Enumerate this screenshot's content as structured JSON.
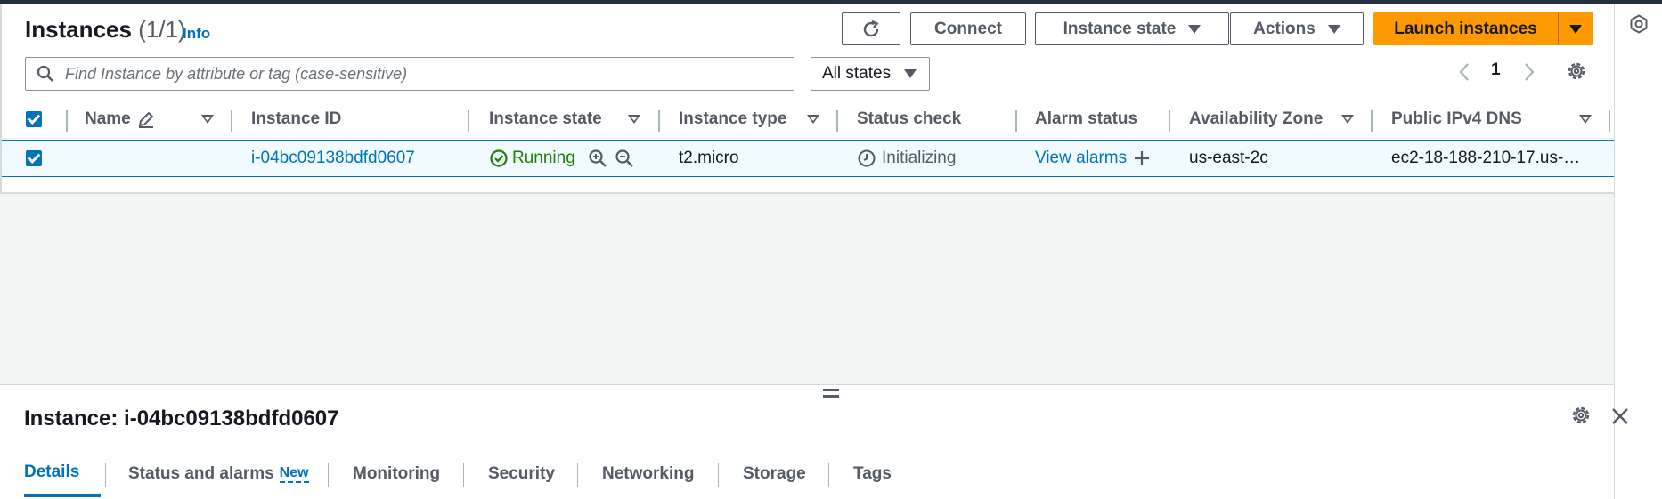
{
  "header": {
    "title": "Instances",
    "count": "(1/1)",
    "info": "Info"
  },
  "toolbar": {
    "connect": "Connect",
    "instance_state": "Instance state",
    "actions": "Actions",
    "launch": "Launch instances"
  },
  "search": {
    "placeholder": "Find Instance by attribute or tag (case-sensitive)"
  },
  "filter": {
    "selected": "All states"
  },
  "pagination": {
    "page": "1"
  },
  "table": {
    "columns": {
      "name": "Name",
      "instance_id": "Instance ID",
      "instance_state": "Instance state",
      "instance_type": "Instance type",
      "status_check": "Status check",
      "alarm_status": "Alarm status",
      "availability_zone": "Availability Zone",
      "public_dns": "Public IPv4 DNS"
    },
    "rows": [
      {
        "instance_id": "i-04bc09138bdfd0607",
        "instance_state": "Running",
        "instance_type": "t2.micro",
        "status_check": "Initializing",
        "alarm_status": "View alarms",
        "availability_zone": "us-east-2c",
        "public_dns": "ec2-18-188-210-17.us-…"
      }
    ]
  },
  "details": {
    "title": "Instance: i-04bc09138bdfd0607",
    "tabs": [
      {
        "label": "Details"
      },
      {
        "label": "Status and alarms",
        "badge": "New"
      },
      {
        "label": "Monitoring"
      },
      {
        "label": "Security"
      },
      {
        "label": "Networking"
      },
      {
        "label": "Storage"
      },
      {
        "label": "Tags"
      }
    ]
  },
  "colors": {
    "accent": "#0073bb",
    "launch": "#ff9900",
    "running": "#1d8102",
    "nav": "#232f3e"
  }
}
